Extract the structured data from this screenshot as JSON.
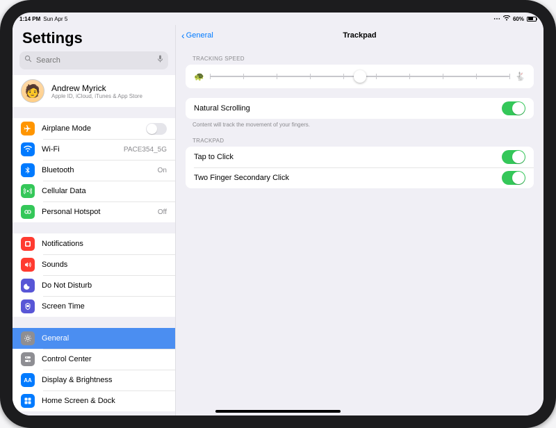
{
  "status": {
    "time": "1:14 PM",
    "date": "Sun Apr 5",
    "battery": "60%"
  },
  "sidebar": {
    "title": "Settings",
    "search_placeholder": "Search",
    "account": {
      "name": "Andrew Myrick",
      "sub": "Apple ID, iCloud, iTunes & App Store"
    },
    "rows": [
      {
        "icon": "airplane",
        "color": "c-orange",
        "label": "Airplane Mode",
        "accessory": "switch-off"
      },
      {
        "icon": "wifi",
        "color": "c-blue",
        "label": "Wi-Fi",
        "value": "PACE354_5G"
      },
      {
        "icon": "bt",
        "color": "c-blue",
        "label": "Bluetooth",
        "value": "On"
      },
      {
        "icon": "cell",
        "color": "c-green",
        "label": "Cellular Data",
        "value": ""
      },
      {
        "icon": "hotspot",
        "color": "c-green",
        "label": "Personal Hotspot",
        "value": "Off"
      }
    ],
    "rows2": [
      {
        "icon": "notif",
        "color": "c-red",
        "label": "Notifications"
      },
      {
        "icon": "sound",
        "color": "c-red",
        "label": "Sounds"
      },
      {
        "icon": "dnd",
        "color": "c-indigo",
        "label": "Do Not Disturb"
      },
      {
        "icon": "screentime",
        "color": "c-indigo",
        "label": "Screen Time"
      }
    ],
    "rows3": [
      {
        "icon": "gear",
        "color": "c-gray",
        "label": "General",
        "selected": true
      },
      {
        "icon": "cc",
        "color": "c-gray",
        "label": "Control Center"
      },
      {
        "icon": "display",
        "color": "c-blue2",
        "label": "Display & Brightness"
      },
      {
        "icon": "home",
        "color": "c-blue2",
        "label": "Home Screen & Dock"
      }
    ]
  },
  "detail": {
    "back": "General",
    "title": "Trackpad",
    "section_tracking": "TRACKING SPEED",
    "slider": {
      "position": 0.5,
      "ticks": 10
    },
    "rows1": [
      {
        "label": "Natural Scrolling",
        "on": true
      }
    ],
    "footnote1": "Content will track the movement of your fingers.",
    "section_trackpad": "TRACKPAD",
    "rows2": [
      {
        "label": "Tap to Click",
        "on": true
      },
      {
        "label": "Two Finger Secondary Click",
        "on": true
      }
    ]
  }
}
